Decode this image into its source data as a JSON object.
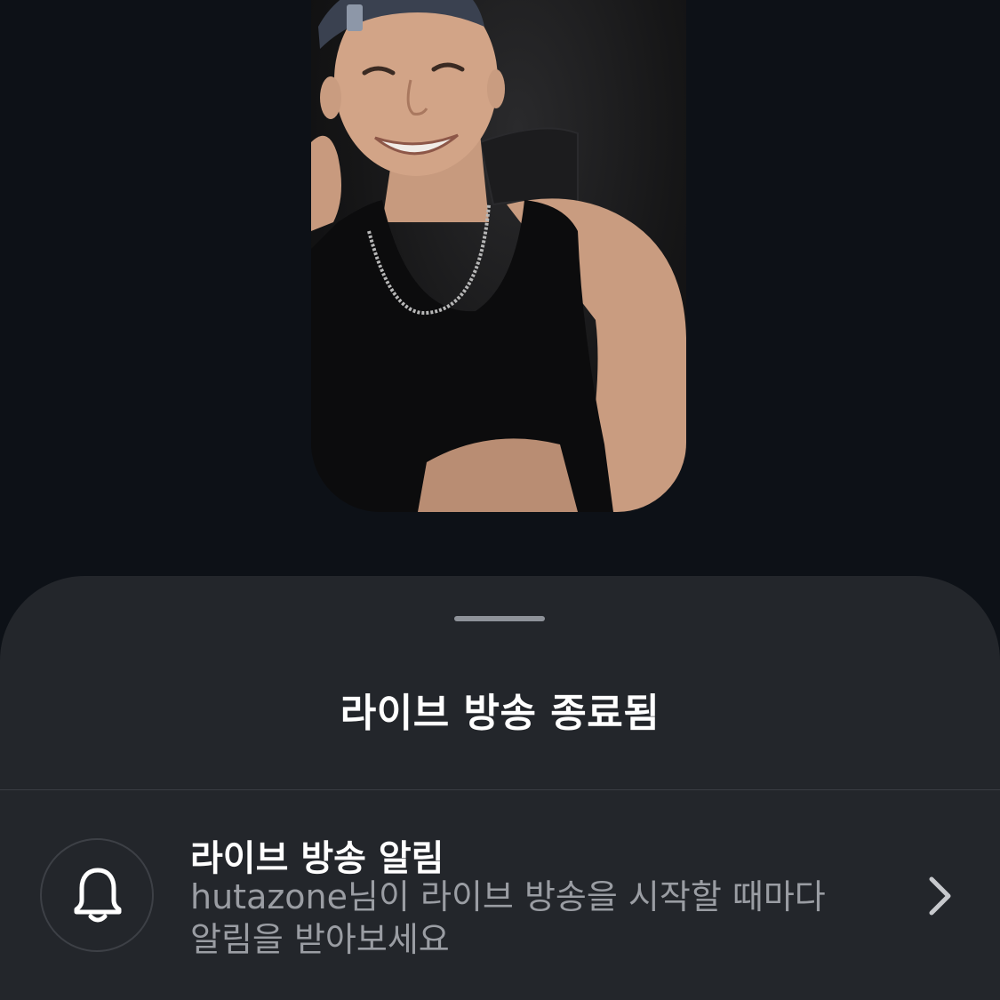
{
  "preview": {
    "description": "live video preview"
  },
  "sheet": {
    "title": "라이브 방송 종료됨",
    "notification_row": {
      "title": "라이브 방송 알림",
      "description_line1": "hutazone님이 라이브 방송을 시작할 때마다",
      "description_line2": "알림을 받아보세요",
      "icon": "bell-icon",
      "action_icon": "chevron-right-icon"
    }
  },
  "colors": {
    "background": "#0d1117",
    "sheet": "#23262b",
    "title_text": "#ffffff",
    "secondary_text": "#9a9da3"
  }
}
